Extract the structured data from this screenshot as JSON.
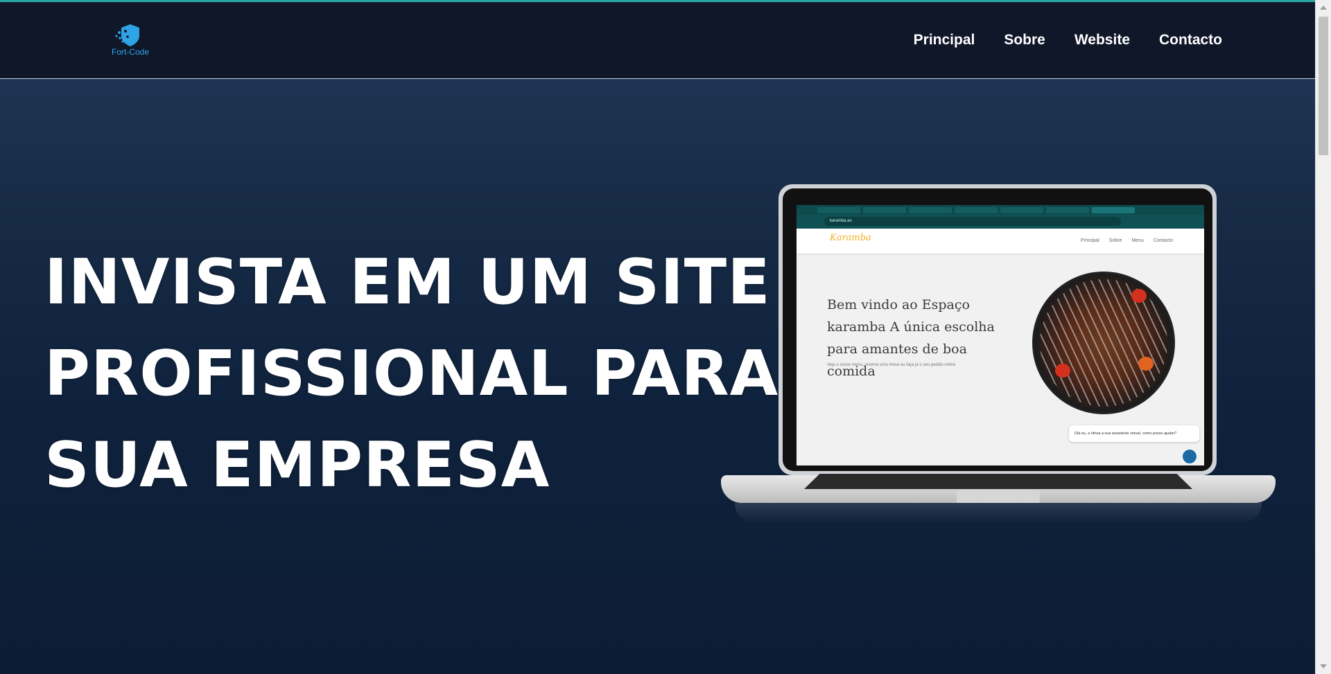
{
  "header": {
    "logo_text": "Fort-Code",
    "nav": [
      "Principal",
      "Sobre",
      "Website",
      "Contacto"
    ]
  },
  "hero": {
    "headline_lines": [
      "INVISTA EM UM SITE",
      "PROFISSIONAL PARA",
      "SUA EMPRESA"
    ]
  },
  "laptop_screen": {
    "url": "karamba.ao",
    "site_logo": "Karamba",
    "site_nav": [
      "Principal",
      "Sobre",
      "Menu",
      "Contacto"
    ],
    "welcome_lines": [
      "Bem vindo ao Espaço",
      "karamba A única escolha",
      "para amantes de boa comida"
    ],
    "welcome_sub": "Veja o nosso menu, reserve uma mesa ou faça já o seu pedido online",
    "chat_text": "Olá eu, a Idrisa a sua assistente virtual, como posso ajudar?"
  },
  "colors": {
    "header_bg": "#0f1729",
    "accent_line": "#2aa6a6",
    "logo_blue": "#2ea3e6"
  }
}
